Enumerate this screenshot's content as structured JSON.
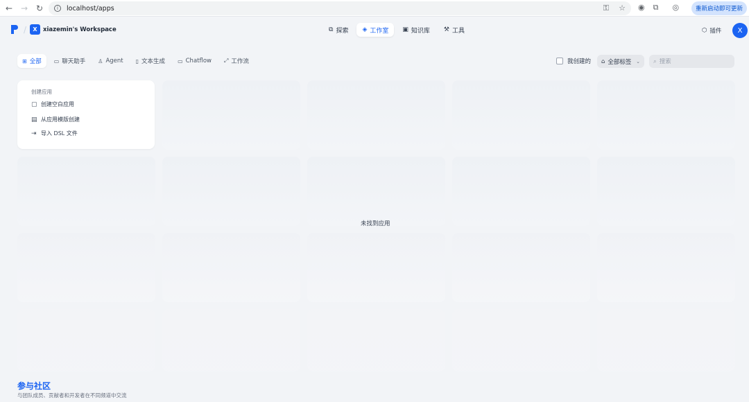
{
  "browser": {
    "url": "localhost/apps",
    "update_button": "重新启动即可更新"
  },
  "header": {
    "workspace_initial": "X",
    "workspace_name": "xiazemin's Workspace",
    "nav": [
      {
        "label": "探索",
        "icon": "explore-icon",
        "active": false
      },
      {
        "label": "工作室",
        "icon": "robot-icon",
        "active": true
      },
      {
        "label": "知识库",
        "icon": "book-icon",
        "active": false
      },
      {
        "label": "工具",
        "icon": "hammer-icon",
        "active": false
      }
    ],
    "plugin_label": "插件",
    "user_initial": "X"
  },
  "filters": {
    "tabs": [
      {
        "label": "全部",
        "icon": "grid-icon",
        "active": true
      },
      {
        "label": "聊天助手",
        "icon": "chat-icon",
        "active": false
      },
      {
        "label": "Agent",
        "icon": "agent-icon",
        "active": false
      },
      {
        "label": "文本生成",
        "icon": "doc-icon",
        "active": false
      },
      {
        "label": "Chatflow",
        "icon": "chatflow-icon",
        "active": false
      },
      {
        "label": "工作流",
        "icon": "workflow-icon",
        "active": false
      }
    ],
    "mine_label": "我创建的",
    "tag_filter_label": "全部标签",
    "search_placeholder": "搜索"
  },
  "create_card": {
    "title": "创建应用",
    "options": [
      {
        "label": "创建空白应用",
        "icon": "blank-app-icon"
      },
      {
        "label": "从应用模版创建",
        "icon": "template-icon"
      },
      {
        "label": "导入 DSL 文件",
        "icon": "import-icon"
      }
    ]
  },
  "empty_message": "未找到应用",
  "community": {
    "title": "参与社区",
    "description": "与团队成员、贡献者和开发者在不同频道中交流"
  }
}
